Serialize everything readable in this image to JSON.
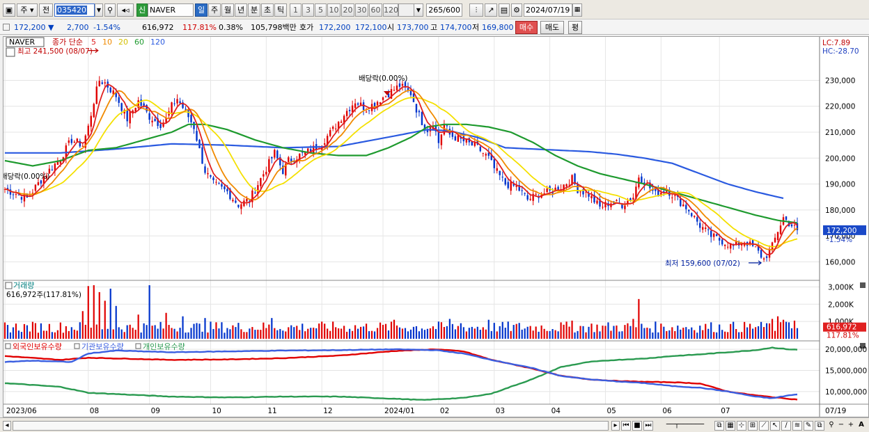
{
  "toolbar": {
    "market": "주",
    "prev": "전",
    "code": "035420",
    "name_badge": "신",
    "name": "NAVER",
    "periods": [
      "일",
      "주",
      "월",
      "년",
      "분",
      "초",
      "틱"
    ],
    "active_period": "일",
    "intervals": [
      "1",
      "3",
      "5",
      "10",
      "20",
      "30",
      "60",
      "120"
    ],
    "count": "265",
    "count_max": "/600",
    "date": "2024/07/19"
  },
  "quote": {
    "price": "172,200",
    "arrow": "▼",
    "change": "2,700",
    "change_pct": "-1.54%",
    "volume": "616,972",
    "vol_ratio": "117.81%",
    "turnover": "0.38%",
    "amount": "105,798백만",
    "ask_label": "호가",
    "ask1": "172,200",
    "ask2": "172,100",
    "open_label": "시",
    "open": "173,700",
    "high_label": "고",
    "high": "174,700",
    "low_label": "저",
    "low": "169,800",
    "buy": "매수",
    "sell": "매도",
    "eval": "평"
  },
  "chart_data": {
    "type": "candlestick",
    "title": "NAVER",
    "legend_prefix": "종가 단순",
    "ma_periods": [
      5,
      10,
      20,
      60,
      120
    ],
    "ma_colors": [
      "#e02020",
      "#f08a00",
      "#f4e000",
      "#1e9a2e",
      "#2a5ae0"
    ],
    "price_ylim": [
      155000,
      243000
    ],
    "price_ticks": [
      "230,000",
      "220,000",
      "210,000",
      "200,000",
      "190,000",
      "180,000",
      "170,000",
      "160,000"
    ],
    "price_tick_values": [
      230000,
      220000,
      210000,
      200000,
      190000,
      180000,
      170000,
      160000
    ],
    "lc": "LC:7.89",
    "hc": "HC:-28.70",
    "last_price": "172,200",
    "last_change": "-1.54%",
    "last_price_value": 172200,
    "high_label": "최고 241,500 (08/07)",
    "high_value": 241500,
    "low_label": "최저 159,600 (07/02)",
    "low_value": 159600,
    "dividend_label": "배당락(0.00%)",
    "dividend_label_left": "배당락(0.00%)",
    "x_labels": [
      "2023/06",
      "08",
      "09",
      "10",
      "11",
      "12",
      "2024/01",
      "02",
      "03",
      "04",
      "05",
      "06",
      "07",
      "07/19"
    ],
    "close_anchors": [
      [
        0,
        188000
      ],
      [
        8,
        184500
      ],
      [
        14,
        193000
      ],
      [
        20,
        200000
      ],
      [
        24,
        207000
      ],
      [
        28,
        205000
      ],
      [
        30,
        212000
      ],
      [
        32,
        222000
      ],
      [
        34,
        230000
      ],
      [
        36,
        229000
      ],
      [
        40,
        224000
      ],
      [
        44,
        215000
      ],
      [
        48,
        222000
      ],
      [
        52,
        216000
      ],
      [
        56,
        213000
      ],
      [
        58,
        215000
      ],
      [
        60,
        220000
      ],
      [
        62,
        223000
      ],
      [
        66,
        216000
      ],
      [
        68,
        212000
      ],
      [
        70,
        203000
      ],
      [
        72,
        195000
      ],
      [
        75,
        190000
      ],
      [
        80,
        187000
      ],
      [
        84,
        182000
      ],
      [
        88,
        184000
      ],
      [
        90,
        188000
      ],
      [
        94,
        196000
      ],
      [
        97,
        202000
      ],
      [
        100,
        195000
      ],
      [
        102,
        199000
      ],
      [
        106,
        201000
      ],
      [
        110,
        203000
      ],
      [
        114,
        206000
      ],
      [
        118,
        211000
      ],
      [
        122,
        217000
      ],
      [
        126,
        222000
      ],
      [
        130,
        219000
      ],
      [
        134,
        222000
      ],
      [
        138,
        225000
      ],
      [
        142,
        228000
      ],
      [
        146,
        225000
      ],
      [
        148,
        219000
      ],
      [
        150,
        214000
      ],
      [
        152,
        211000
      ],
      [
        154,
        214000
      ],
      [
        156,
        206000
      ],
      [
        158,
        213000
      ],
      [
        160,
        209000
      ],
      [
        166,
        206000
      ],
      [
        170,
        204000
      ],
      [
        174,
        200000
      ],
      [
        176,
        196000
      ],
      [
        180,
        190000
      ],
      [
        184,
        189000
      ],
      [
        188,
        184000
      ],
      [
        192,
        186000
      ],
      [
        196,
        187000
      ],
      [
        200,
        189000
      ],
      [
        204,
        192000
      ],
      [
        206,
        188000
      ],
      [
        210,
        186000
      ],
      [
        214,
        181000
      ],
      [
        218,
        183000
      ],
      [
        222,
        182000
      ],
      [
        226,
        185000
      ],
      [
        228,
        193000
      ],
      [
        230,
        191000
      ],
      [
        234,
        186000
      ],
      [
        238,
        188000
      ],
      [
        242,
        184000
      ],
      [
        246,
        180000
      ],
      [
        250,
        174000
      ],
      [
        254,
        170000
      ],
      [
        258,
        168000
      ],
      [
        262,
        166000
      ],
      [
        266,
        168000
      ],
      [
        270,
        165000
      ],
      [
        273,
        161000
      ],
      [
        276,
        166000
      ],
      [
        278,
        172000
      ],
      [
        280,
        177000
      ],
      [
        282,
        175000
      ],
      [
        285,
        172200
      ]
    ],
    "ma60_anchors": [
      [
        0,
        199000
      ],
      [
        10,
        197000
      ],
      [
        20,
        199000
      ],
      [
        30,
        203000
      ],
      [
        40,
        204000
      ],
      [
        50,
        207000
      ],
      [
        60,
        210000
      ],
      [
        66,
        213000
      ],
      [
        72,
        213000
      ],
      [
        80,
        211000
      ],
      [
        90,
        207000
      ],
      [
        100,
        204000
      ],
      [
        110,
        202000
      ],
      [
        120,
        201000
      ],
      [
        130,
        201000
      ],
      [
        138,
        204000
      ],
      [
        146,
        208000
      ],
      [
        152,
        212000
      ],
      [
        158,
        213000
      ],
      [
        166,
        213000
      ],
      [
        174,
        212000
      ],
      [
        182,
        210000
      ],
      [
        190,
        206000
      ],
      [
        198,
        201000
      ],
      [
        206,
        197000
      ],
      [
        214,
        194000
      ],
      [
        222,
        192000
      ],
      [
        230,
        190000
      ],
      [
        240,
        187000
      ],
      [
        250,
        184000
      ],
      [
        260,
        181000
      ],
      [
        270,
        178000
      ],
      [
        278,
        176000
      ],
      [
        285,
        175000
      ]
    ],
    "ma120_anchors": [
      [
        0,
        202000
      ],
      [
        20,
        202000
      ],
      [
        40,
        203500
      ],
      [
        60,
        205500
      ],
      [
        80,
        205000
      ],
      [
        100,
        204000
      ],
      [
        120,
        204500
      ],
      [
        140,
        208500
      ],
      [
        152,
        211000
      ],
      [
        160,
        210500
      ],
      [
        170,
        208000
      ],
      [
        180,
        204000
      ],
      [
        190,
        203500
      ],
      [
        200,
        203000
      ],
      [
        210,
        202500
      ],
      [
        220,
        201500
      ],
      [
        230,
        200000
      ],
      [
        240,
        198000
      ],
      [
        250,
        194000
      ],
      [
        260,
        190000
      ],
      [
        270,
        187000
      ],
      [
        280,
        184500
      ]
    ],
    "volume_title": "거래량",
    "volume_label": "616,972주(117.81%)",
    "volume_ticks": [
      "3,000K",
      "2,000K",
      "1,000K"
    ],
    "volume_tick_values": [
      3000000,
      2000000,
      1000000
    ],
    "volume_ylim": [
      0,
      3300000
    ],
    "last_volume": "616,972",
    "last_volume_pct": "117.81%",
    "last_volume_value": 616972,
    "volume_spikes": [
      [
        28,
        1600000
      ],
      [
        30,
        3050000
      ],
      [
        32,
        3100000
      ],
      [
        34,
        2700000
      ],
      [
        36,
        2200000
      ],
      [
        38,
        2900000
      ],
      [
        40,
        1900000
      ],
      [
        48,
        1400000
      ],
      [
        52,
        3100000
      ],
      [
        58,
        1500000
      ],
      [
        64,
        1300000
      ],
      [
        72,
        1200000
      ],
      [
        96,
        1200000
      ],
      [
        140,
        1100000
      ],
      [
        160,
        1150000
      ],
      [
        164,
        900000
      ],
      [
        174,
        1100000
      ],
      [
        204,
        1050000
      ],
      [
        228,
        2300000
      ],
      [
        226,
        1150000
      ],
      [
        274,
        900000
      ],
      [
        276,
        1150000
      ],
      [
        278,
        1300000
      ],
      [
        280,
        1100000
      ],
      [
        282,
        950000
      ],
      [
        284,
        1050000
      ]
    ],
    "holders": [
      {
        "name": "외국인보유수량",
        "color": "#e00000"
      },
      {
        "name": "기관보유수량",
        "color": "#3a5ee0"
      },
      {
        "name": "개인보유수량",
        "color": "#2a9a50"
      }
    ],
    "holders_ylim": [
      7500000,
      21500000
    ],
    "holders_ticks": [
      "20,000,000",
      "15,000,000",
      "10,000,000"
    ],
    "holders_tick_values": [
      20000000,
      15000000,
      10000000
    ],
    "foreign_anchors": [
      [
        0,
        18400000
      ],
      [
        20,
        17500000
      ],
      [
        30,
        18000000
      ],
      [
        60,
        17500000
      ],
      [
        80,
        17600000
      ],
      [
        100,
        17900000
      ],
      [
        120,
        18500000
      ],
      [
        140,
        19600000
      ],
      [
        155,
        20000000
      ],
      [
        165,
        19500000
      ],
      [
        175,
        17500000
      ],
      [
        190,
        15400000
      ],
      [
        200,
        13700000
      ],
      [
        210,
        12900000
      ],
      [
        220,
        12500000
      ],
      [
        230,
        12300000
      ],
      [
        240,
        12200000
      ],
      [
        250,
        11900000
      ],
      [
        260,
        10000000
      ],
      [
        270,
        9100000
      ],
      [
        280,
        8400000
      ],
      [
        285,
        8100000
      ]
    ],
    "institution_anchors": [
      [
        0,
        17000000
      ],
      [
        10,
        17300000
      ],
      [
        24,
        17000000
      ],
      [
        30,
        19000000
      ],
      [
        40,
        19700000
      ],
      [
        60,
        19300000
      ],
      [
        80,
        19500000
      ],
      [
        100,
        19700000
      ],
      [
        120,
        19800000
      ],
      [
        140,
        20000000
      ],
      [
        155,
        19800000
      ],
      [
        165,
        19000000
      ],
      [
        175,
        17500000
      ],
      [
        190,
        15500000
      ],
      [
        200,
        13700000
      ],
      [
        210,
        12900000
      ],
      [
        220,
        12400000
      ],
      [
        230,
        12000000
      ],
      [
        240,
        11300000
      ],
      [
        250,
        10900000
      ],
      [
        260,
        10000000
      ],
      [
        270,
        8800000
      ],
      [
        276,
        8400000
      ],
      [
        282,
        9100000
      ],
      [
        285,
        9300000
      ]
    ],
    "individual_anchors": [
      [
        0,
        12000000
      ],
      [
        20,
        11100000
      ],
      [
        30,
        9700000
      ],
      [
        60,
        8800000
      ],
      [
        80,
        8600000
      ],
      [
        100,
        8800000
      ],
      [
        120,
        8800000
      ],
      [
        140,
        8300000
      ],
      [
        150,
        8000000
      ],
      [
        165,
        8500000
      ],
      [
        175,
        9500000
      ],
      [
        190,
        13000000
      ],
      [
        200,
        15800000
      ],
      [
        210,
        17000000
      ],
      [
        220,
        17500000
      ],
      [
        230,
        17800000
      ],
      [
        240,
        18400000
      ],
      [
        250,
        18800000
      ],
      [
        260,
        19300000
      ],
      [
        270,
        19800000
      ],
      [
        276,
        20400000
      ],
      [
        282,
        20000000
      ],
      [
        285,
        19900000
      ]
    ],
    "candle_count": 286
  },
  "status": {
    "zoom_icons": [
      "zoom-out",
      "minus",
      "plus",
      "font-size"
    ]
  }
}
